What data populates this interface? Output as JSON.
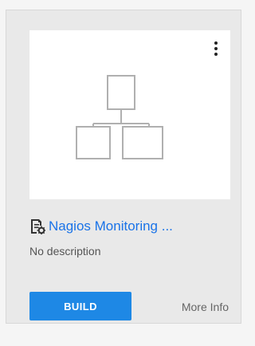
{
  "card": {
    "title": "Nagios Monitoring ...",
    "description": "No description",
    "thumbnail_icon": "hierarchy-diagram-icon",
    "title_icon": "document-gear-icon",
    "menu_icon": "kebab-menu-icon",
    "build_label": "BUILD",
    "more_info_label": "More Info"
  },
  "colors": {
    "build_button": "#1e88e5",
    "link": "#1a73e8",
    "card_background": "#e9e9e9"
  }
}
